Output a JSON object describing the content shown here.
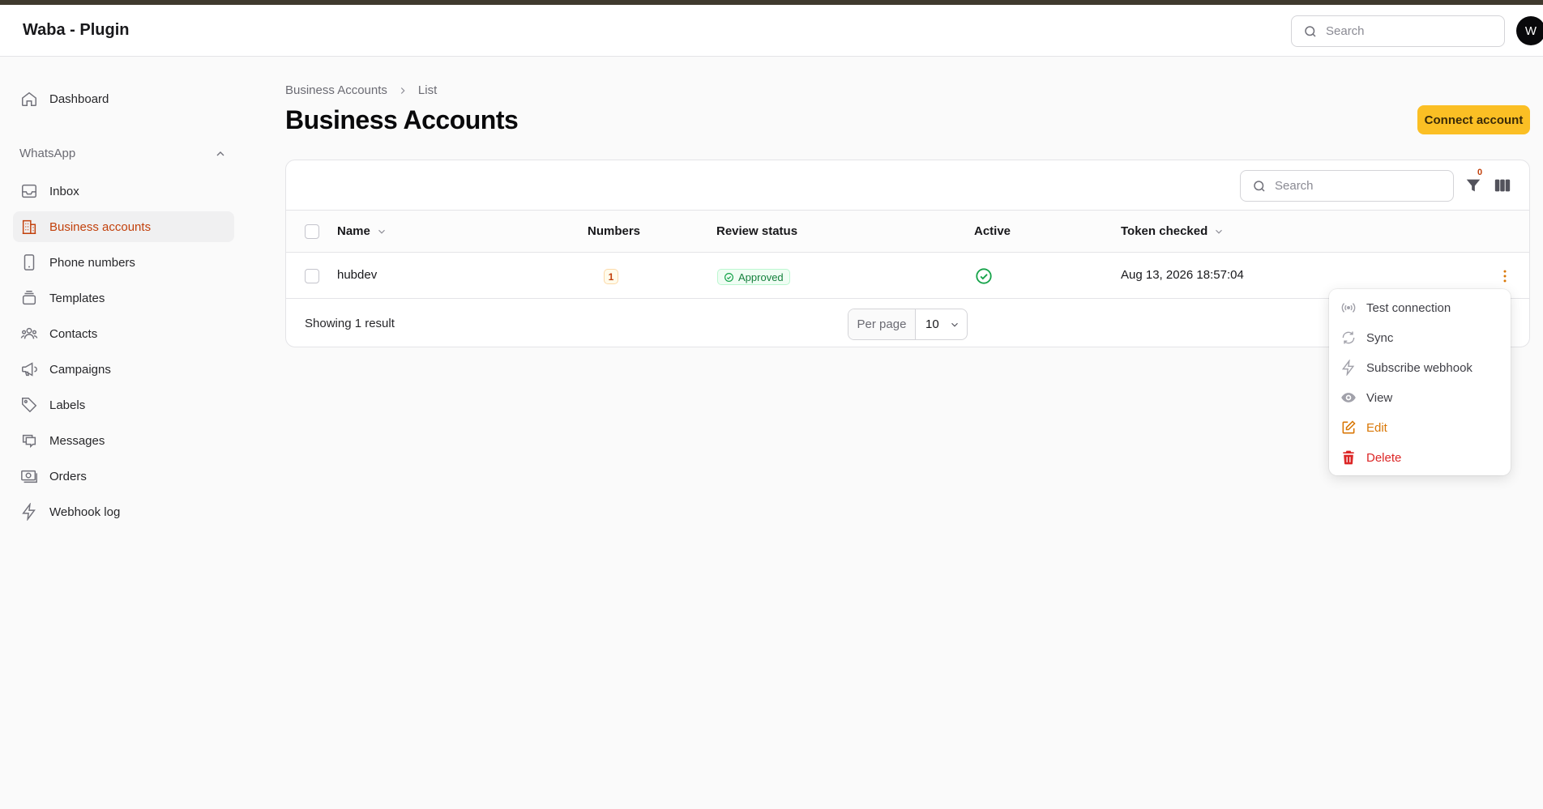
{
  "app": {
    "title": "Waba - Plugin",
    "avatar_initial": "W"
  },
  "topbar": {
    "search_placeholder": "Search"
  },
  "sidebar": {
    "dashboard": "Dashboard",
    "group_label": "WhatsApp",
    "items": [
      {
        "label": "Inbox",
        "icon": "inbox-icon"
      },
      {
        "label": "Business accounts",
        "icon": "building-icon",
        "active": true
      },
      {
        "label": "Phone numbers",
        "icon": "phone-icon"
      },
      {
        "label": "Templates",
        "icon": "stack-icon"
      },
      {
        "label": "Contacts",
        "icon": "users-icon"
      },
      {
        "label": "Campaigns",
        "icon": "megaphone-icon"
      },
      {
        "label": "Labels",
        "icon": "tag-icon"
      },
      {
        "label": "Messages",
        "icon": "chat-icon"
      },
      {
        "label": "Orders",
        "icon": "cash-icon"
      },
      {
        "label": "Webhook log",
        "icon": "bolt-icon"
      }
    ]
  },
  "breadcrumb": {
    "parent": "Business Accounts",
    "current": "List"
  },
  "page": {
    "title": "Business Accounts",
    "connect_button": "Connect account"
  },
  "table": {
    "search_placeholder": "Search",
    "filter_count": "0",
    "columns": {
      "name": "Name",
      "numbers": "Numbers",
      "review_status": "Review status",
      "active": "Active",
      "token_checked": "Token checked"
    },
    "rows": [
      {
        "name": "hubdev",
        "numbers": "1",
        "review_status": "Approved",
        "active": true,
        "token_checked": "Aug 13, 2026 18:57:04"
      }
    ],
    "footer": {
      "showing": "Showing 1 result",
      "per_page_label": "Per page",
      "per_page_value": "10"
    }
  },
  "row_menu": {
    "items": [
      {
        "label": "Test connection",
        "icon": "signal-icon"
      },
      {
        "label": "Sync",
        "icon": "refresh-icon"
      },
      {
        "label": "Subscribe webhook",
        "icon": "bolt-icon"
      },
      {
        "label": "View",
        "icon": "eye-icon"
      },
      {
        "label": "Edit",
        "icon": "edit-icon",
        "color": "#d97706"
      },
      {
        "label": "Delete",
        "icon": "trash-icon",
        "color": "#dc2626"
      }
    ]
  },
  "colors": {
    "accent": "#c2410c",
    "primary_button": "#fbbf24",
    "success": "#16a34a",
    "danger": "#dc2626",
    "warning": "#d97706"
  }
}
